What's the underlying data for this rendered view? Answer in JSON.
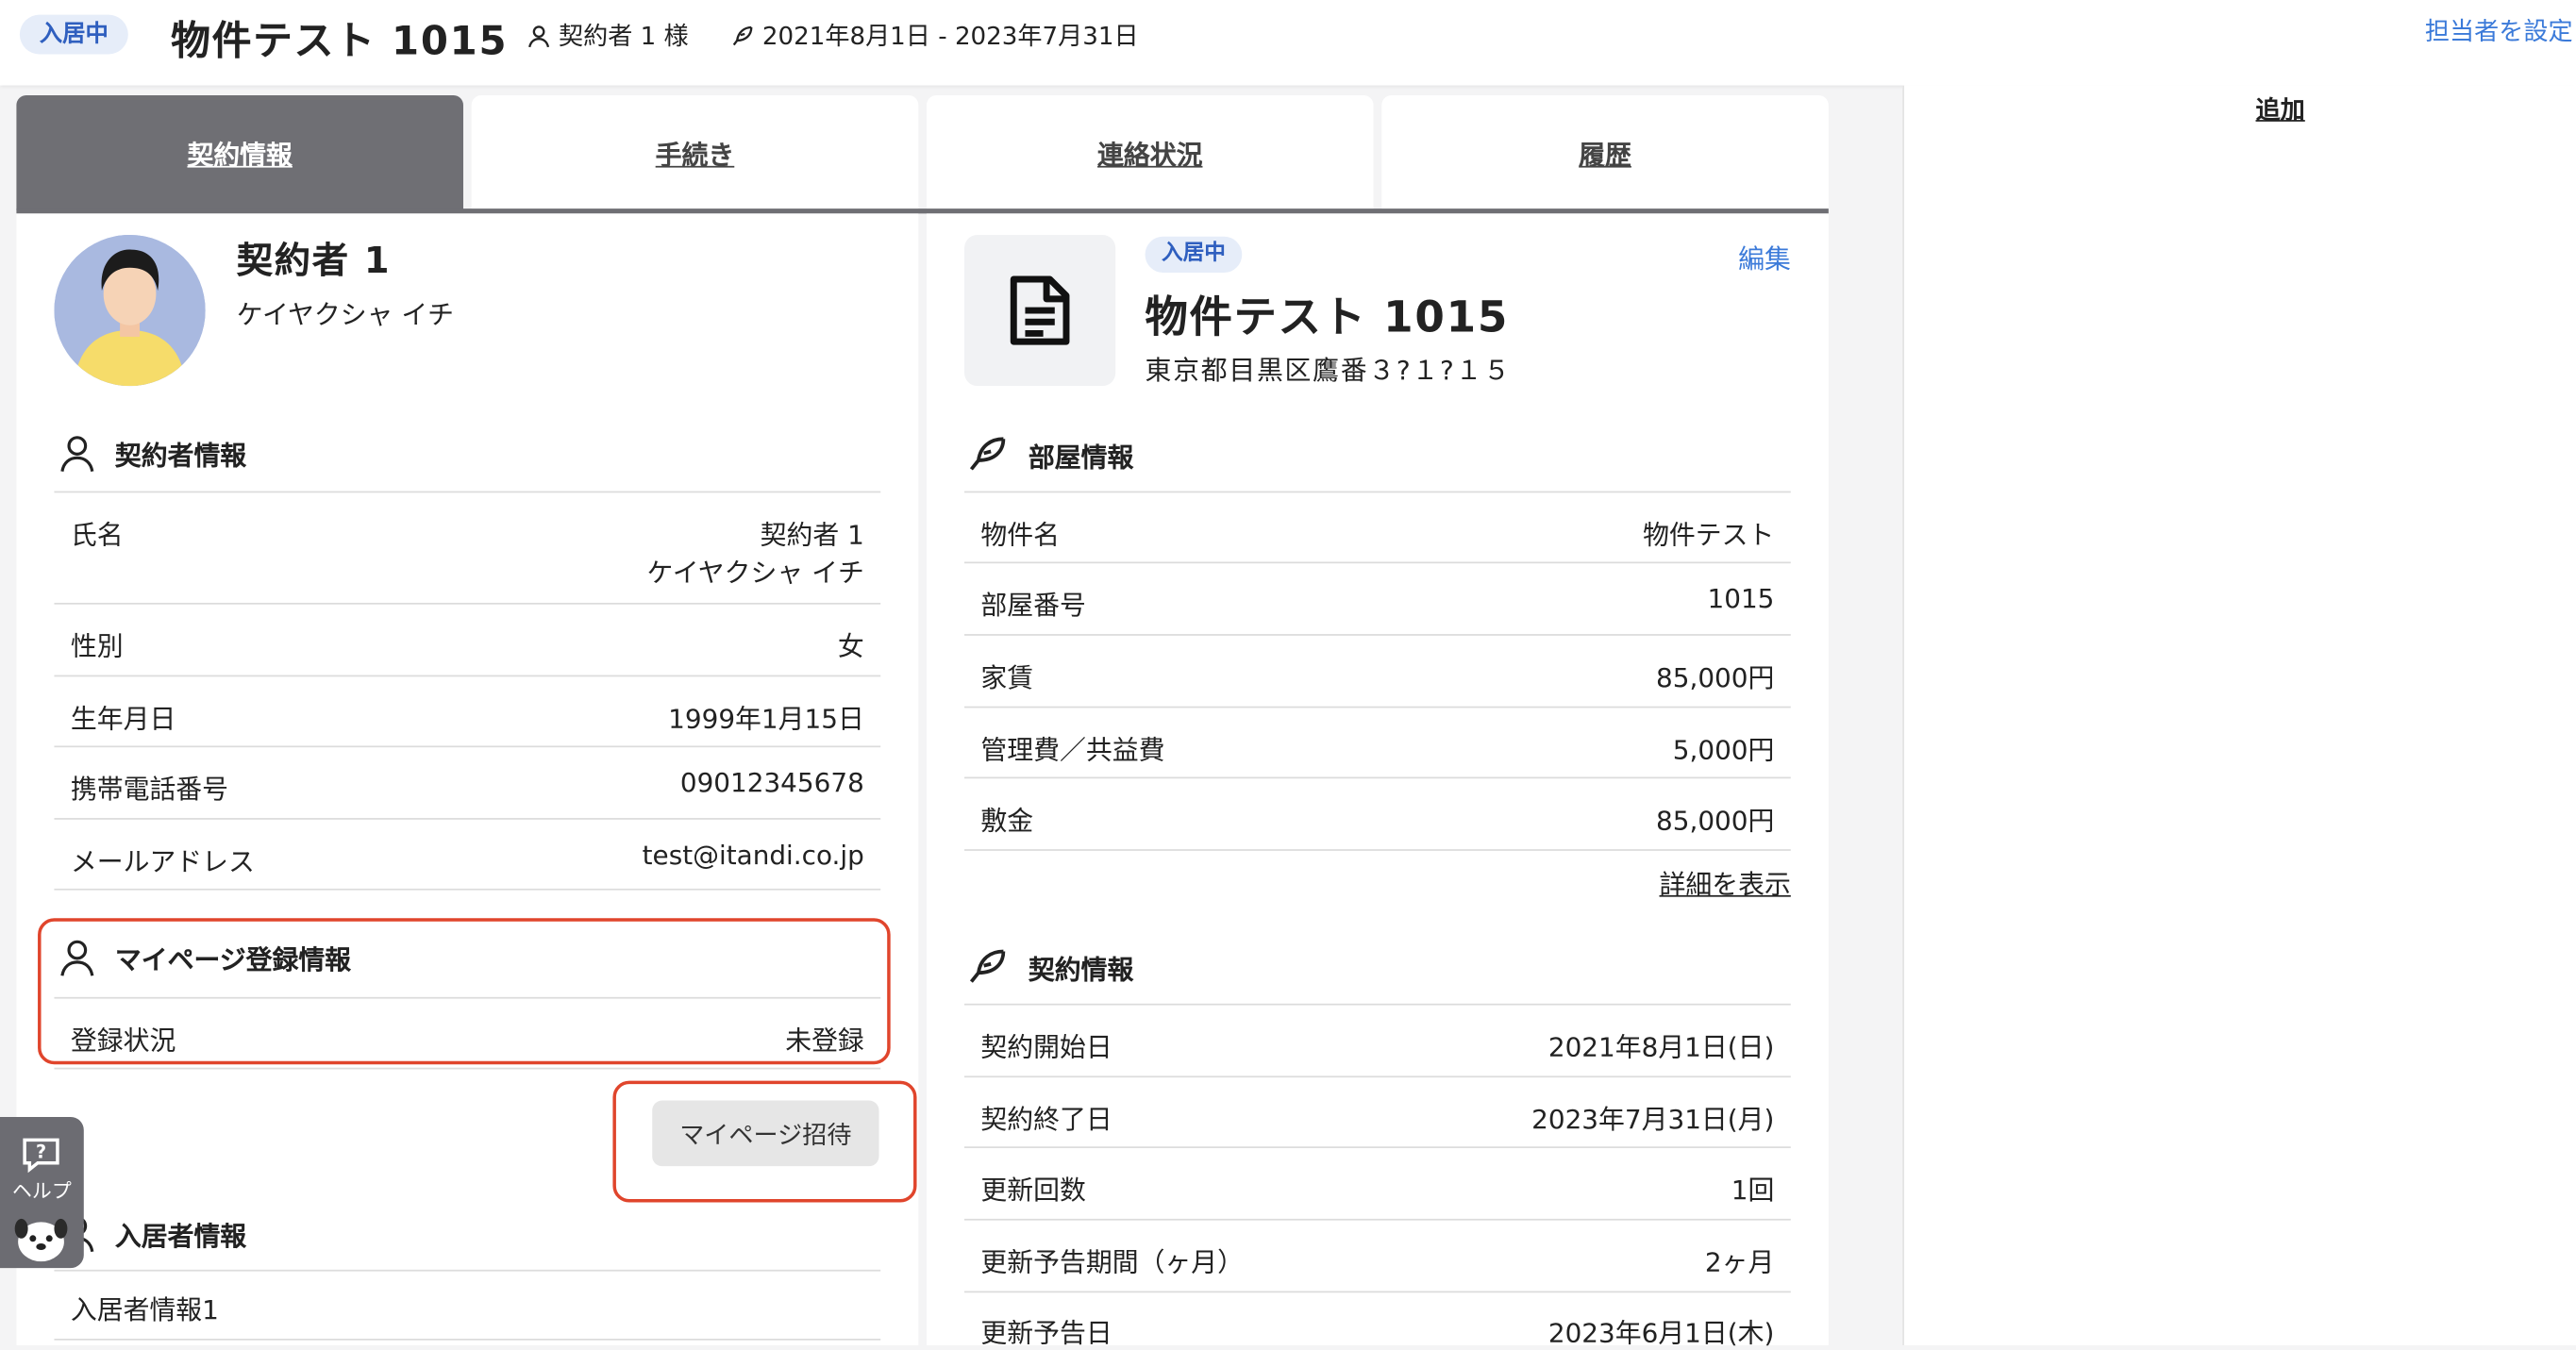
{
  "header": {
    "status": "入居中",
    "title": "物件テスト 1015",
    "contractor": "契約者 1 様",
    "period": "2021年8月1日 - 2023年7月31日",
    "assign_link": "担当者を設定"
  },
  "right_panel": {
    "add_link": "追加"
  },
  "tabs": [
    {
      "label": "契約情報",
      "active": true
    },
    {
      "label": "手続き"
    },
    {
      "label": "連絡状況"
    },
    {
      "label": "履歴"
    }
  ],
  "contractor": {
    "name": "契約者 1",
    "kana": "ケイヤクシャ イチ",
    "info_title": "契約者情報",
    "rows": [
      {
        "label": "氏名",
        "value": "契約者 1",
        "value2": "ケイヤクシャ イチ"
      },
      {
        "label": "性別",
        "value": "女"
      },
      {
        "label": "生年月日",
        "value": "1999年1月15日"
      },
      {
        "label": "携帯電話番号",
        "value": "09012345678"
      },
      {
        "label": "メールアドレス",
        "value": "test@itandi.co.jp"
      }
    ],
    "mypage_title": "マイページ登録情報",
    "mypage_rows": [
      {
        "label": "登録状況",
        "value": "未登録"
      }
    ],
    "invite_button": "マイページ招待",
    "resident_title": "入居者情報",
    "resident_rows": [
      {
        "label": "入居者情報1"
      }
    ]
  },
  "property": {
    "status": "入居中",
    "title": "物件テスト 1015",
    "address": "東京都目黒区鷹番３?１?１５",
    "edit_link": "編集",
    "room_title": "部屋情報",
    "room_rows": [
      {
        "label": "物件名",
        "value": "物件テスト"
      },
      {
        "label": "部屋番号",
        "value": "1015"
      },
      {
        "label": "家賃",
        "value": "85,000円"
      },
      {
        "label": "管理費／共益費",
        "value": "5,000円"
      },
      {
        "label": "敷金",
        "value": "85,000円"
      }
    ],
    "detail_link": "詳細を表示",
    "contract_title": "契約情報",
    "contract_rows": [
      {
        "label": "契約開始日",
        "value": "2021年8月1日(日)"
      },
      {
        "label": "契約終了日",
        "value": "2023年7月31日(月)"
      },
      {
        "label": "更新回数",
        "value": "1回"
      },
      {
        "label": "更新予告期間（ヶ月）",
        "value": "2ヶ月"
      },
      {
        "label": "更新予告日",
        "value": "2023年6月1日(木)"
      }
    ]
  },
  "help": {
    "label": "ヘルプ"
  },
  "colors": {
    "accent": "#3b7ad9",
    "tab_active": "#6f6f74",
    "highlight": "#e0452c",
    "badge_bg": "#e6edf9"
  }
}
